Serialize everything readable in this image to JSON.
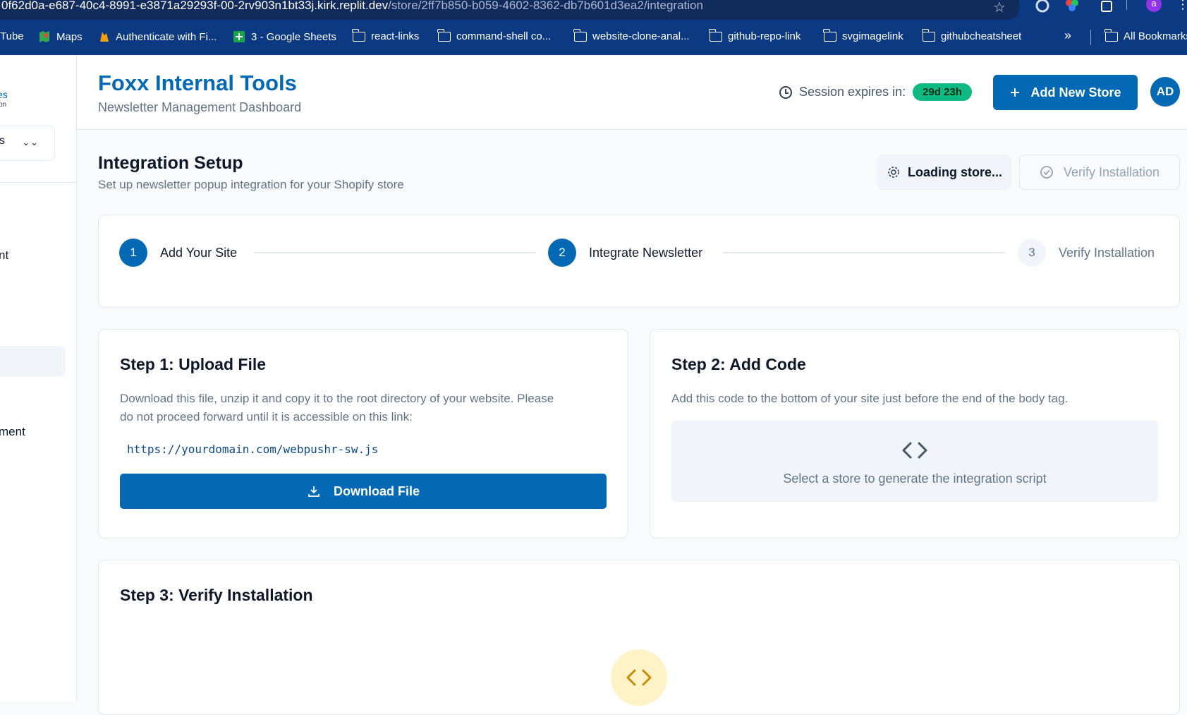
{
  "browser": {
    "url_host": "0f62d0a-e687-40c4-8991-e3871a29293f-00-2rv903n1bt33j.kirk.replit.dev",
    "url_path": "/store/2ff7b850-b059-4602-8362-db7b601d3ea2/integration",
    "profile_initial": "a",
    "bookmarks": [
      "Tube",
      "Maps",
      "Authenticate with Fi...",
      "3 - Google Sheets",
      "react-links",
      "command-shell co...",
      "website-clone-anal...",
      "github-repo-link",
      "svgimagelink",
      "githubcheatsheet"
    ],
    "more": "»",
    "all_bookmarks": "All Bookmarks"
  },
  "sidebar": {
    "brand_line1": "es",
    "brand_line2": "on",
    "select_text": "s",
    "select_chevron": "⌄⌄",
    "items": [
      "nt",
      "ment"
    ]
  },
  "header": {
    "title": "Foxx Internal Tools",
    "subtitle": "Newsletter Management Dashboard",
    "session_label": "Session expires in:",
    "session_value": "29d 23h",
    "add_store": "Add New Store",
    "avatar": "AD"
  },
  "page": {
    "title": "Integration Setup",
    "subtitle": "Set up newsletter popup integration for your Shopify store",
    "loading_btn": "Loading store...",
    "verify_btn": "Verify Installation"
  },
  "stepper": [
    {
      "num": "1",
      "label": "Add Your Site"
    },
    {
      "num": "2",
      "label": "Integrate Newsletter"
    },
    {
      "num": "3",
      "label": "Verify Installation"
    }
  ],
  "step1": {
    "title": "Step 1: Upload File",
    "desc_line1": "Download this file, unzip it and copy it to the root directory of your website. Please",
    "desc_line2": "do not proceed forward until it is accessible on this link:",
    "link": "https://yourdomain.com/webpushr-sw.js",
    "button": "Download File"
  },
  "step2": {
    "title": "Step 2: Add Code",
    "desc": "Add this code to the bottom of your site just before the end of the body tag.",
    "placeholder": "Select a store to generate the integration script"
  },
  "step3": {
    "title": "Step 3: Verify Installation"
  },
  "colors": {
    "primary": "#0369b4",
    "chrome": "#0b3a82",
    "badge": "#10b981",
    "yellow": "#fef3c7"
  }
}
